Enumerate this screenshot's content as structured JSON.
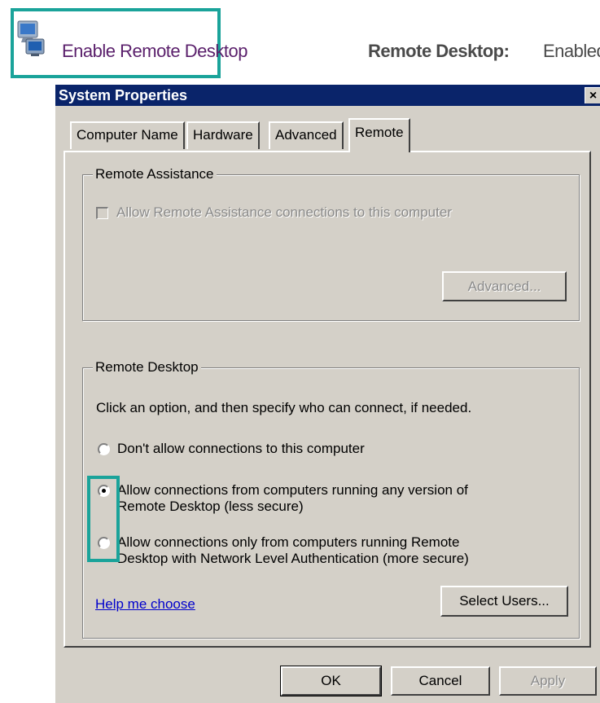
{
  "header": {
    "enable_label": "Enable Remote Desktop",
    "rd_label": "Remote Desktop:",
    "rd_status": "Enabled"
  },
  "dialog": {
    "title": "System Properties",
    "close_glyph": "×",
    "tabs": [
      "Computer Name",
      "Hardware",
      "Advanced",
      "Remote"
    ],
    "active_tab": "Remote",
    "remote_assistance": {
      "legend": "Remote Assistance",
      "checkbox_label": "Allow Remote Assistance connections to this computer",
      "checkbox_checked": false,
      "advanced_button": "Advanced..."
    },
    "remote_desktop": {
      "legend": "Remote Desktop",
      "instruction": "Click an option, and then specify who can connect, if needed.",
      "options": [
        {
          "line1": "Don't allow connections to this computer",
          "line2": "",
          "selected": false
        },
        {
          "line1": "Allow connections from computers running any version of",
          "line2": "Remote Desktop (less secure)",
          "selected": true
        },
        {
          "line1": "Allow connections only from computers running Remote",
          "line2": "Desktop with Network Level Authentication (more secure)",
          "selected": false
        }
      ],
      "help_link": "Help me choose",
      "select_users_button": "Select Users..."
    },
    "buttons": {
      "ok": "OK",
      "cancel": "Cancel",
      "apply": "Apply"
    }
  },
  "colors": {
    "highlight": "#1aa39a",
    "titlebar": "#0a246a",
    "dialog_bg": "#d4d0c8"
  }
}
